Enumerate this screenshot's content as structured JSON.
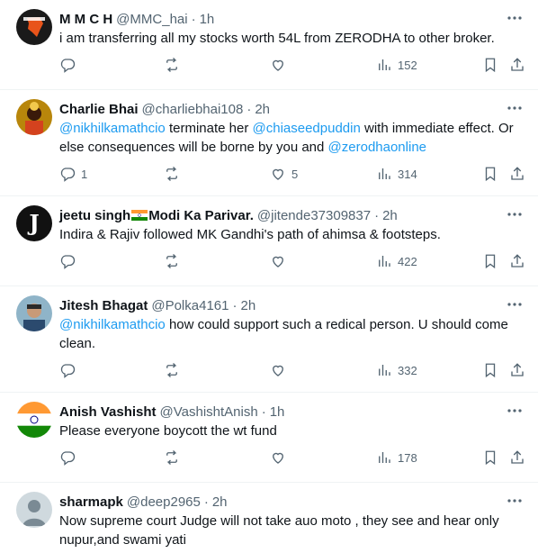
{
  "tweets": [
    {
      "name": "M M C H",
      "handle": "@MMC_hai",
      "dot": "·",
      "time": "1h",
      "text": "i am transferring all my stocks worth 54L from ZERODHA to other broker.",
      "replies": "",
      "retweets": "",
      "likes": "",
      "views": "152"
    },
    {
      "name": "Charlie Bhai",
      "handle": "@charliebhai108",
      "dot": "·",
      "time": "2h",
      "parts": [
        {
          "t": "@nikhilkamathcio",
          "m": true
        },
        {
          "t": " terminate her ",
          "m": false
        },
        {
          "t": "@chiaseedpuddin",
          "m": true
        },
        {
          "t": " with immediate effect. Or else consequences will be borne by you and ",
          "m": false
        },
        {
          "t": "@zerodhaonline",
          "m": true
        }
      ],
      "replies": "1",
      "retweets": "",
      "likes": "5",
      "views": "314"
    },
    {
      "name_a": "jeetu singh",
      "name_b": "Modi Ka Parivar.",
      "handle": "@jitende37309837",
      "dot": "·",
      "time": "2h",
      "text": "Indira & Rajiv followed MK Gandhi's path of ahimsa & footsteps.",
      "replies": "",
      "retweets": "",
      "likes": "",
      "views": "422"
    },
    {
      "name": "Jitesh Bhagat",
      "handle": "@Polka4161",
      "dot": "·",
      "time": "2h",
      "parts": [
        {
          "t": "@nikhilkamathcio",
          "m": true
        },
        {
          "t": " how could support such a redical person. U should come clean.",
          "m": false
        }
      ],
      "replies": "",
      "retweets": "",
      "likes": "",
      "views": "332"
    },
    {
      "name": "Anish Vashisht",
      "handle": "@VashishtAnish",
      "dot": "·",
      "time": "1h",
      "text": "Please everyone boycott the wt fund",
      "replies": "",
      "retweets": "",
      "likes": "",
      "views": "178"
    },
    {
      "name": "sharmapk",
      "handle": "@deep2965",
      "dot": "·",
      "time": "2h",
      "text": "Now supreme court Judge will not take auo moto , they see and hear only nupur,and swami yati"
    }
  ],
  "colors": {
    "accent": "#1d9bf0",
    "text": "#0f1419",
    "muted": "#536471",
    "divider": "#eff3f4"
  },
  "icons": [
    "more-icon",
    "reply-icon",
    "retweet-icon",
    "like-icon",
    "views-icon",
    "bookmark-icon",
    "share-icon"
  ]
}
